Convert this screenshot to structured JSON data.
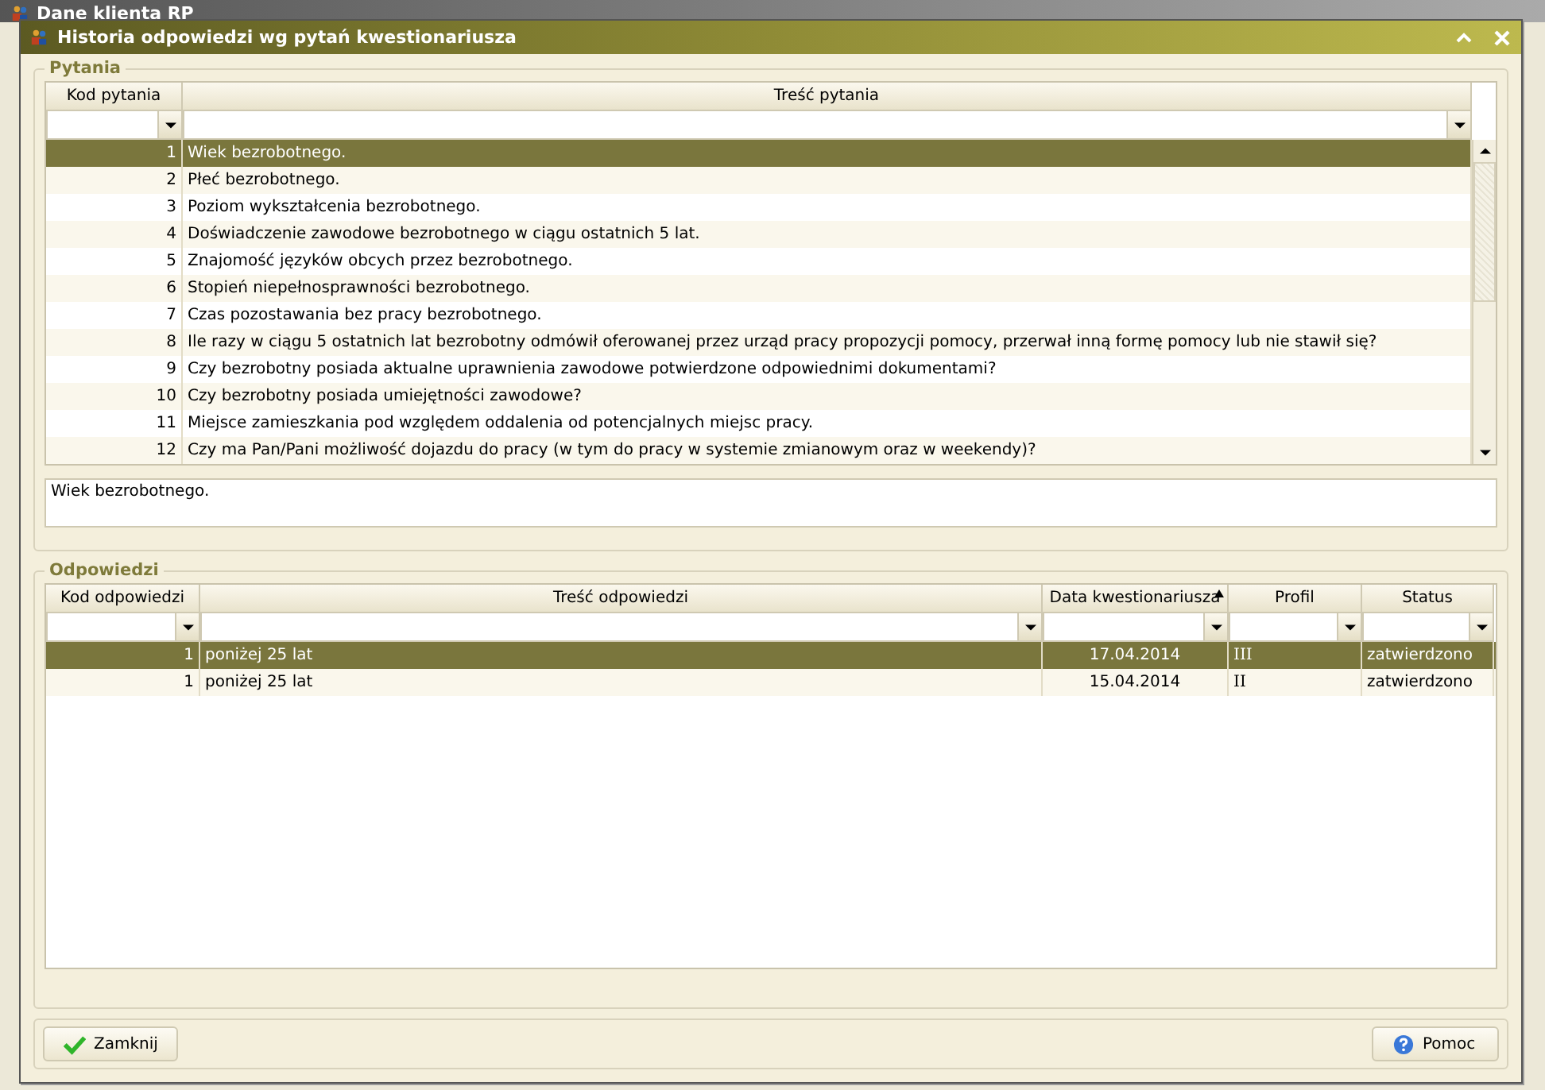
{
  "background_window": {
    "title": "Dane klienta RP"
  },
  "window": {
    "title": "Historia odpowiedzi wg pytań kwestionariusza"
  },
  "questions": {
    "legend": "Pytania",
    "columns": [
      {
        "label": "Kod pytania",
        "sorted": false
      },
      {
        "label": "Treść pytania",
        "sorted": false
      }
    ],
    "rows": [
      {
        "code": "1",
        "text": "Wiek bezrobotnego.",
        "selected": true
      },
      {
        "code": "2",
        "text": "Płeć bezrobotnego.",
        "selected": false
      },
      {
        "code": "3",
        "text": "Poziom wykształcenia bezrobotnego.",
        "selected": false
      },
      {
        "code": "4",
        "text": "Doświadczenie zawodowe bezrobotnego w ciągu ostatnich 5 lat.",
        "selected": false
      },
      {
        "code": "5",
        "text": "Znajomość języków obcych przez bezrobotnego.",
        "selected": false
      },
      {
        "code": "6",
        "text": "Stopień niepełnosprawności bezrobotnego.",
        "selected": false
      },
      {
        "code": "7",
        "text": "Czas pozostawania bez pracy bezrobotnego.",
        "selected": false
      },
      {
        "code": "8",
        "text": "Ile razy w ciągu 5 ostatnich lat bezrobotny odmówił oferowanej przez urząd pracy propozycji pomocy, przerwał inną formę pomocy lub nie stawił się?",
        "selected": false
      },
      {
        "code": "9",
        "text": "Czy bezrobotny posiada aktualne uprawnienia zawodowe potwierdzone odpowiednimi dokumentami?",
        "selected": false
      },
      {
        "code": "10",
        "text": "Czy bezrobotny posiada umiejętności zawodowe?",
        "selected": false
      },
      {
        "code": "11",
        "text": "Miejsce zamieszkania pod względem oddalenia od potencjalnych miejsc pracy.",
        "selected": false
      },
      {
        "code": "12",
        "text": "Czy ma Pan/Pani możliwość dojazdu do pracy (w tym do pracy w systemie zmianowym oraz w weekendy)?",
        "selected": false
      }
    ],
    "detail": "Wiek bezrobotnego."
  },
  "answers": {
    "legend": "Odpowiedzi",
    "columns": [
      {
        "label": "Kod odpowiedzi",
        "sorted": false
      },
      {
        "label": "Treść odpowiedzi",
        "sorted": false
      },
      {
        "label": "Data kwestionariusza",
        "sorted": true
      },
      {
        "label": "Profil",
        "sorted": false
      },
      {
        "label": "Status",
        "sorted": false
      }
    ],
    "rows": [
      {
        "cells": [
          "1",
          "poniżej 25 lat",
          "17.04.2014",
          "III",
          "zatwierdzono"
        ],
        "selected": true
      },
      {
        "cells": [
          "1",
          "poniżej 25 lat",
          "15.04.2014",
          "II",
          "zatwierdzono"
        ],
        "selected": false
      }
    ]
  },
  "buttons": [
    {
      "kind": "close",
      "label": "Zamknij"
    },
    {
      "kind": "help",
      "label": "Pomoc"
    }
  ]
}
